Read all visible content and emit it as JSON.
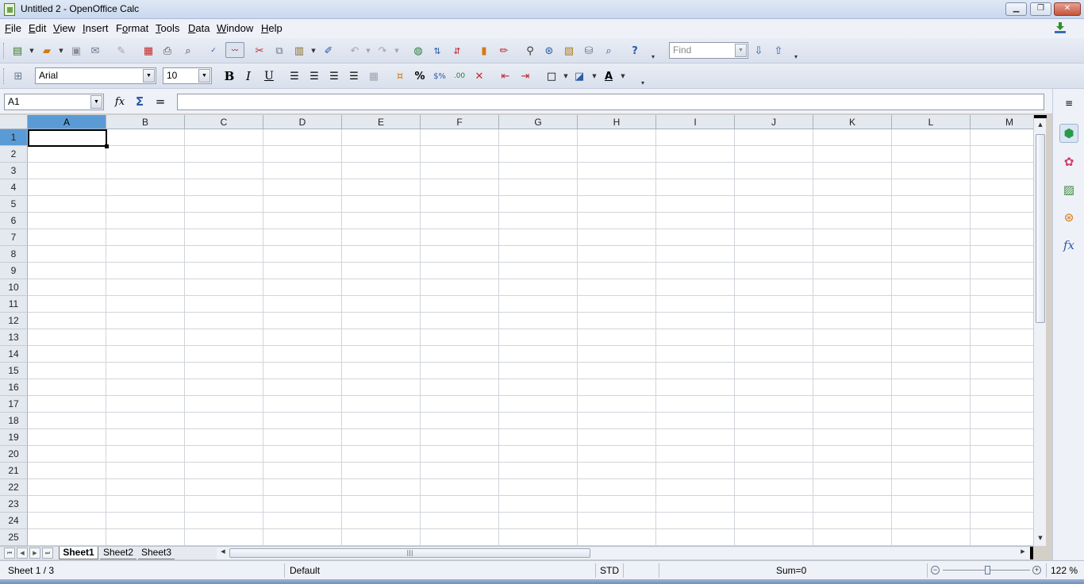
{
  "window": {
    "title": "Untitled 2 - OpenOffice Calc",
    "controls": [
      "minimize",
      "restore",
      "close"
    ]
  },
  "menu": [
    {
      "pre": "",
      "key": "F",
      "post": "ile"
    },
    {
      "pre": "",
      "key": "E",
      "post": "dit"
    },
    {
      "pre": "",
      "key": "V",
      "post": "iew"
    },
    {
      "pre": "",
      "key": "I",
      "post": "nsert"
    },
    {
      "pre": "F",
      "key": "o",
      "post": "rmat"
    },
    {
      "pre": "",
      "key": "T",
      "post": "ools"
    },
    {
      "pre": "",
      "key": "D",
      "post": "ata"
    },
    {
      "pre": "",
      "key": "W",
      "post": "indow"
    },
    {
      "pre": "",
      "key": "H",
      "post": "elp"
    }
  ],
  "standard_toolbar": {
    "find_placeholder": "Find"
  },
  "format_toolbar": {
    "font_name": "Arial",
    "font_size": "10",
    "bold": "B",
    "italic": "I",
    "underline": "U",
    "percent": "%"
  },
  "formula_bar": {
    "name_box": "A1",
    "function_wizard": "fx",
    "sum": "Σ",
    "equals": "=",
    "formula": ""
  },
  "grid": {
    "columns": [
      "A",
      "B",
      "C",
      "D",
      "E",
      "F",
      "G",
      "H",
      "I",
      "J",
      "K",
      "L",
      "M"
    ],
    "rows": [
      "1",
      "2",
      "3",
      "4",
      "5",
      "6",
      "7",
      "8",
      "9",
      "10",
      "11",
      "12",
      "13",
      "14",
      "15",
      "16",
      "17",
      "18",
      "19",
      "20",
      "21",
      "22",
      "23",
      "24",
      "25"
    ],
    "active_cell": "A1"
  },
  "sheets": {
    "tabs": [
      "Sheet1",
      "Sheet2",
      "Sheet3"
    ],
    "active": "Sheet1"
  },
  "status": {
    "sheet_position": "Sheet 1 / 3",
    "page_style": "Default",
    "selection_mode": "STD",
    "sum": "Sum=0",
    "zoom": "122 %"
  },
  "colors": {
    "selected_header": "#5b9bd5",
    "toolbar_bg": "#e9edf5"
  }
}
